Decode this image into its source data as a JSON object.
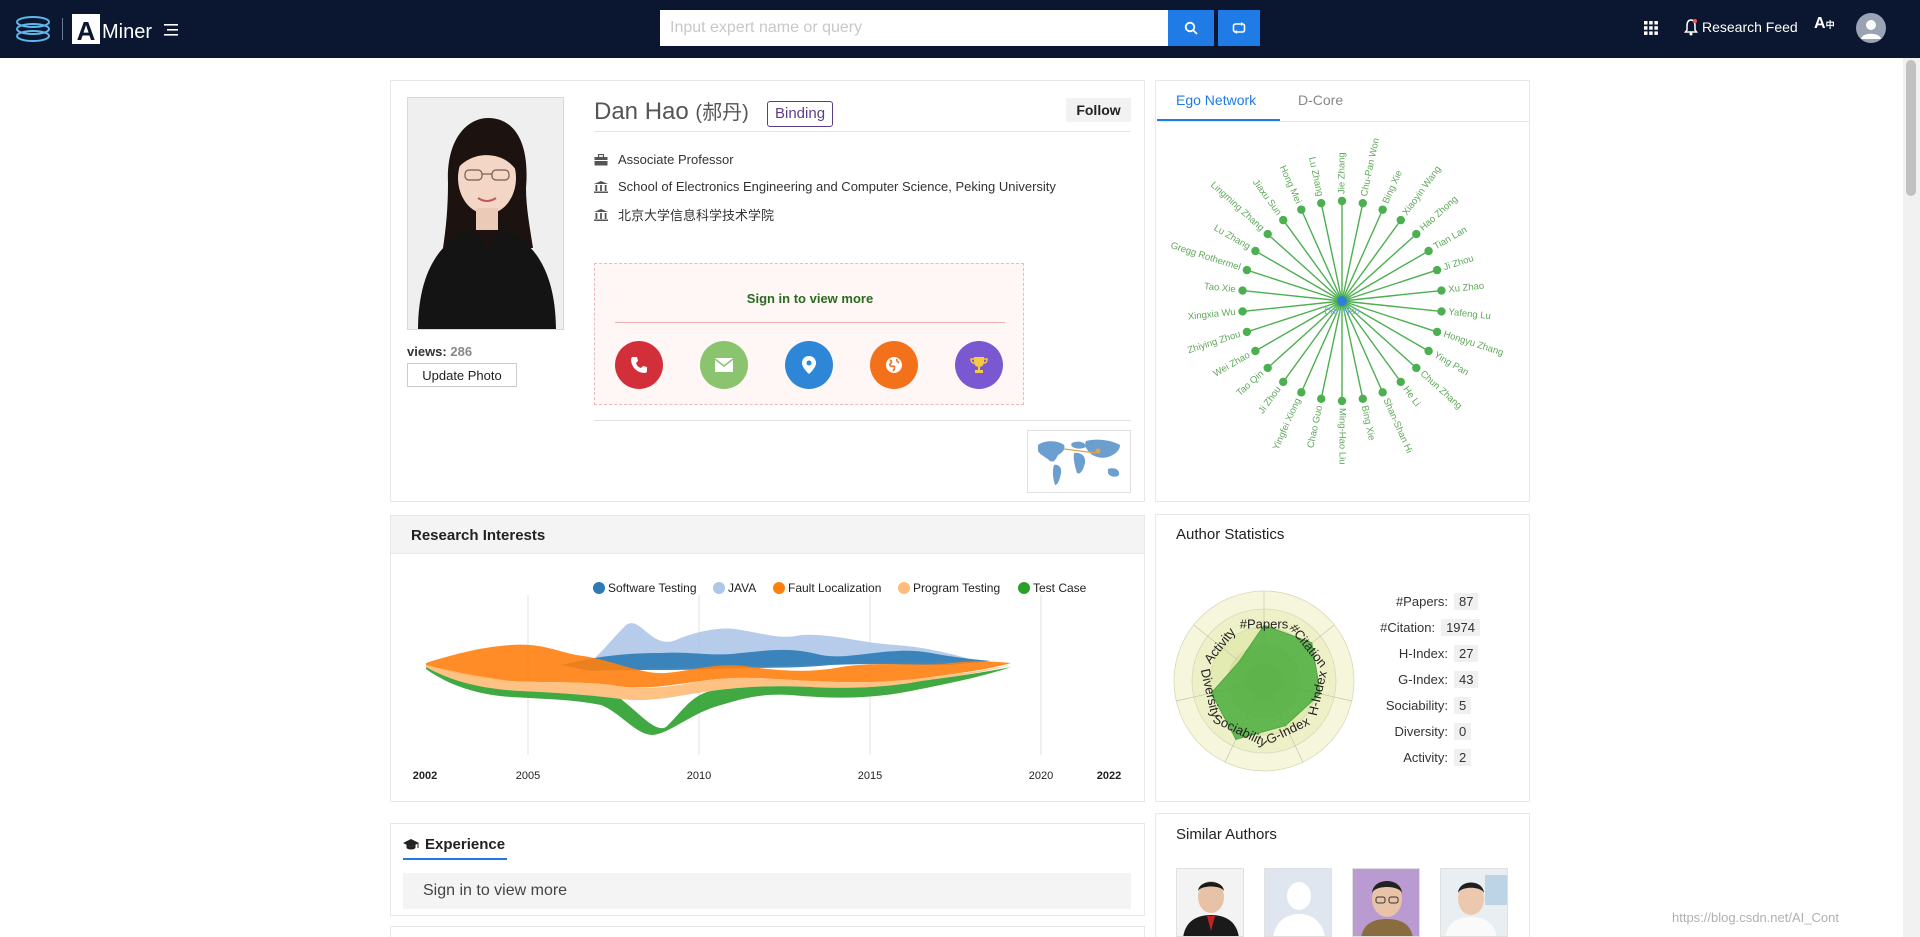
{
  "header": {
    "search_placeholder": "Input expert name or query",
    "research_feed": "Research Feed",
    "lang_label": "A"
  },
  "profile": {
    "name": "Dan Hao",
    "name_cn": "(郝丹)",
    "binding": "Binding",
    "follow": "Follow",
    "title": "Associate Professor",
    "affiliation": "School of Electronics Engineering and Computer Science, Peking University",
    "affiliation_cn": "北京大学信息科学技术学院",
    "views_label": "views:",
    "views": "286",
    "update_photo": "Update Photo",
    "signin_more": "Sign in to view more"
  },
  "ego_network": {
    "tabs": [
      "Ego Network",
      "D-Core"
    ],
    "center": "Dan Hao",
    "nodes": [
      "Jie Zhang",
      "Chu-Pan Won",
      "Bing Xie",
      "Xiaoyin Wang",
      "Hao Zhong",
      "Tian Lan",
      "Ji Zhou",
      "Xu Zhao",
      "Yafeng Lu",
      "Hongyu Zhang",
      "Ying Pan",
      "Chun Zhang",
      "He Li",
      "Shan-Shan Hi",
      "Bing Xie",
      "Ming-Hao Liu",
      "Chao Guo",
      "Yingfei Xiong",
      "Ji Zhou",
      "Tao Qin",
      "Wei Zhao",
      "Zhiying Zhou",
      "Xingxia Wu",
      "Tao Xie",
      "Gregg Rothermel",
      "Lu Zhang",
      "Lingming Zhang",
      "Jiaxu Sun",
      "Hong Mei",
      "Lu Zhang"
    ]
  },
  "research_interests": {
    "title": "Research Interests",
    "legend": [
      {
        "name": "Software Testing",
        "color": "#2c7bb6"
      },
      {
        "name": "JAVA",
        "color": "#aec7e8"
      },
      {
        "name": "Fault Localization",
        "color": "#ff7f0e"
      },
      {
        "name": "Program Testing",
        "color": "#ffbb78"
      },
      {
        "name": "Test Case",
        "color": "#2ca02c"
      }
    ],
    "ticks": [
      "2002",
      "2005",
      "2010",
      "2015",
      "2020",
      "2022"
    ]
  },
  "author_statistics": {
    "title": "Author Statistics",
    "radar_labels": [
      "#Papers",
      "#Citation",
      "H-Index",
      "G-Index",
      "Sociability",
      "Diversity",
      "Activity"
    ],
    "rows": [
      {
        "label": "#Papers:",
        "value": "87"
      },
      {
        "label": "#Citation:",
        "value": "1974"
      },
      {
        "label": "H-Index:",
        "value": "27"
      },
      {
        "label": "G-Index:",
        "value": "43"
      },
      {
        "label": "Sociability:",
        "value": "5"
      },
      {
        "label": "Diversity:",
        "value": "0"
      },
      {
        "label": "Activity:",
        "value": "2"
      }
    ]
  },
  "experience": {
    "title": "Experience",
    "signin": "Sign in to view more"
  },
  "similar_authors": {
    "title": "Similar Authors"
  },
  "watermark": "https://blog.csdn.net/AI_Cont",
  "colors": {
    "topbar": "#0b1730",
    "accent": "#1f7ce6",
    "network": "#4caf50"
  }
}
